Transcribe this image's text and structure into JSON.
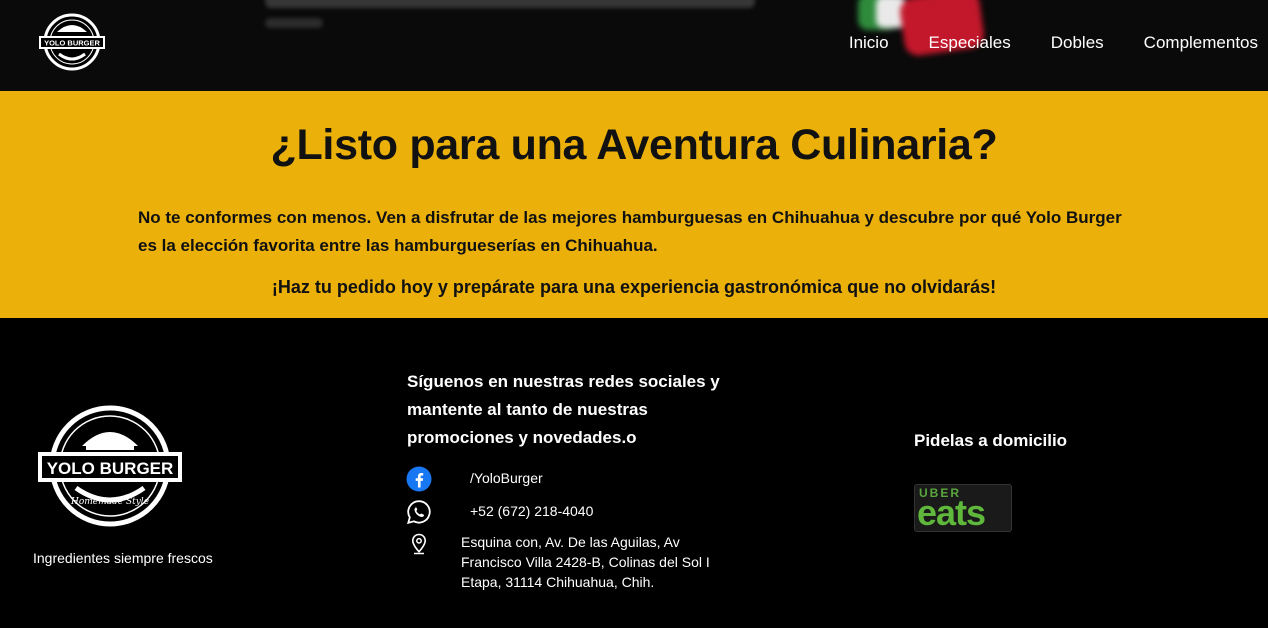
{
  "header": {
    "logo_text": "YOLO BURGER",
    "nav": [
      "Inicio",
      "Especiales",
      "Dobles",
      "Complementos"
    ]
  },
  "band": {
    "title": "¿Listo para una Aventura Culinaria?",
    "paragraph": "No te conformes con menos. Ven a disfrutar de las mejores hamburguesas en Chihuahua y descubre por qué Yolo Burger es la elección favorita entre las hamburgueserías en Chihuahua.",
    "cta": "¡Haz tu pedido hoy y prepárate para una experiencia gastronómica que no olvidarás!",
    "background": "#ebb10a"
  },
  "footer": {
    "logo_text": "YOLO BURGER",
    "logo_subtext": "Homemade Style",
    "tagline": "Ingredientes siempre frescos",
    "social_title": "Síguenos en nuestras redes sociales y mantente al tanto de nuestras promociones y novedades.o",
    "facebook": "/YoloBurger",
    "whatsapp": "+52 (672) 218-4040",
    "address": "Esquina con, Av. De las Aguilas, Av Francisco Villa 2428-B, Colinas del Sol I Etapa, 31114 Chihuahua, Chih.",
    "delivery_title": "Pidelas a domicilio",
    "ubereats_top": "UBER",
    "ubereats_bottom": "eats"
  },
  "icons": {
    "facebook": "facebook-icon",
    "whatsapp": "whatsapp-icon",
    "location": "map-pin-icon"
  }
}
